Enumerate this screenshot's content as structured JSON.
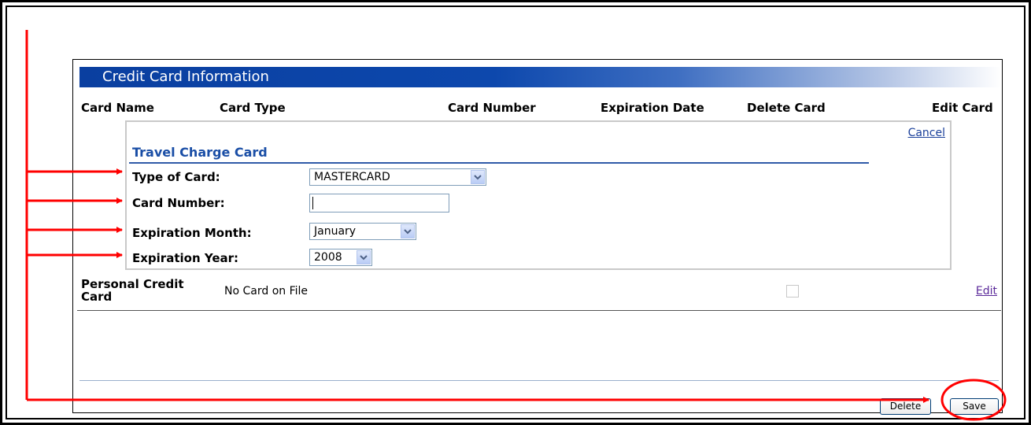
{
  "panel": {
    "title": "Credit Card Information",
    "columns": [
      "Card Name",
      "Card Type",
      "Card Number",
      "Expiration Date",
      "Delete Card",
      "Edit Card"
    ]
  },
  "edit_form": {
    "cancel_label": "Cancel",
    "section_title": "Travel Charge Card",
    "type_label": "Type of Card:",
    "type_value": "MASTERCARD",
    "number_label": "Card Number:",
    "number_value": "",
    "month_label": "Expiration Month:",
    "month_value": "January",
    "year_label": "Expiration Year:",
    "year_value": "2008"
  },
  "personal_row": {
    "label_line1": "Personal Credit",
    "label_line2": "Card",
    "value": "No Card on File",
    "edit_label": "Edit"
  },
  "buttons": {
    "delete_label": "Delete",
    "save_label": "Save"
  },
  "colors": {
    "title_bar": "#0a3fa0",
    "section_title": "#1a4ea6",
    "annotation": "#ff0000"
  }
}
